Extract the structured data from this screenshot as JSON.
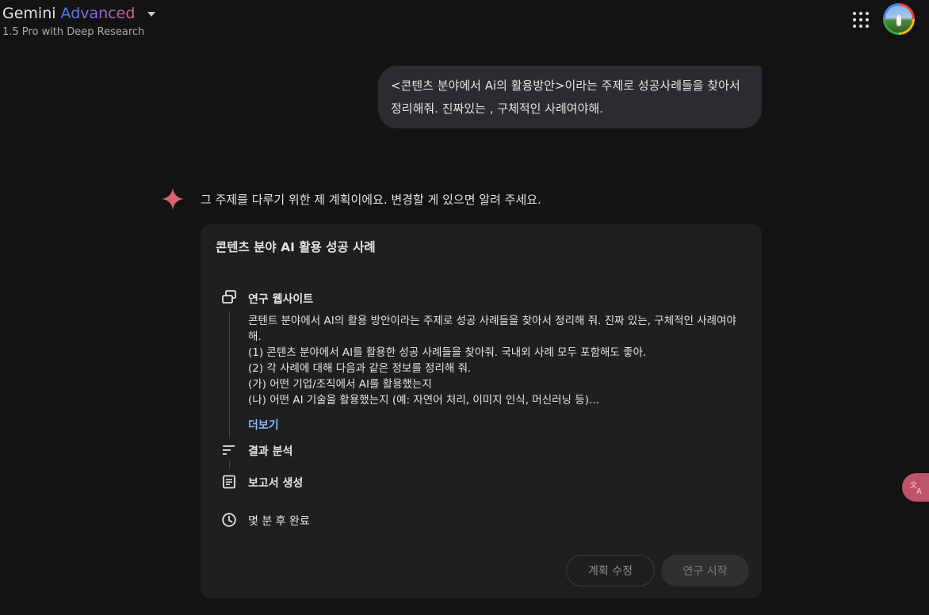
{
  "header": {
    "brand_name": "Gemini",
    "brand_tier": "Advanced",
    "model_subtitle": "1.5 Pro with Deep Research"
  },
  "user_message": {
    "text": "<콘텐츠 분야에서 Ai의 활용방안>이라는 주제로 성공사례들을 찾아서 정리해줘. 진짜있는 , 구체적인 사례여야해."
  },
  "response": {
    "intro": "그 주제를 다루기 위한 제 계획이에요. 변경할 게 있으면 알려 주세요.",
    "plan": {
      "title": "콘텐츠 분야 AI 활용 성공 사례",
      "steps": [
        {
          "label": "연구 웹사이트",
          "icon": "browser-window-icon"
        },
        {
          "label": "결과 분석",
          "icon": "sort-lines-icon"
        },
        {
          "label": "보고서 생성",
          "icon": "document-icon"
        },
        {
          "label": "몇 분 후 완료",
          "icon": "clock-icon"
        }
      ],
      "research_details": [
        "콘텐트 분야에서 AI의 활용 방안이라는 주제로 성공 사례들을 찾아서 정리해 줘. 진짜 있는, 구체적인 사례여야",
        "해.",
        "(1) 콘텐츠 분야에서 AI를 활용한 성공 사례들을 찾아줘. 국내외 사례 모두 포함해도 좋아.",
        "(2) 각 사례에 대해 다음과 같은 정보를 정리해 줘.",
        "(가) 어떤 기업/조직에서 AI를 활용했는지",
        "(나) 어떤 AI 기술을 활용했는지 (예: 자연어 처리, 이미지 인식, 머신러닝 등)..."
      ],
      "more_label": "더보기",
      "edit_button": "계획 수정",
      "start_button": "연구 시작"
    }
  },
  "colors": {
    "background": "#131314",
    "card": "#1e1f20",
    "bubble": "#2b2c2f",
    "link": "#8ab4f8",
    "spark": "#d96570"
  }
}
